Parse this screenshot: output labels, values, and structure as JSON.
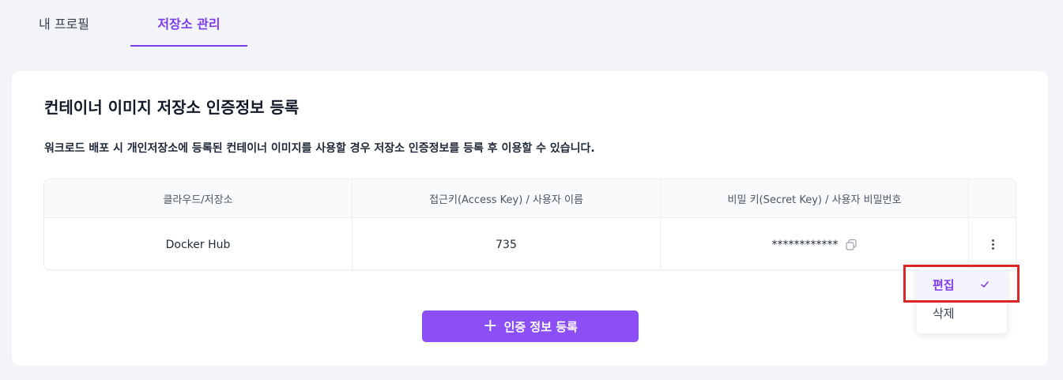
{
  "tabs": [
    {
      "label": "내 프로필",
      "active": false
    },
    {
      "label": "저장소 관리",
      "active": true
    }
  ],
  "card": {
    "title": "컨테이너 이미지 저장소 인증정보 등록",
    "description": "워크로드 배포 시 개인저장소에 등록된 컨테이너 이미지를 사용할 경우 저장소 인증정보를 등록 후 이용할 수 있습니다."
  },
  "table": {
    "columns": [
      "클라우드/저장소",
      "접근키(Access Key) / 사용자 이름",
      "비밀 키(Secret Key) / 사용자 비밀번호",
      ""
    ],
    "rows": [
      {
        "registry": "Docker Hub",
        "access_key": "735",
        "secret_key": "************"
      }
    ]
  },
  "add_button": {
    "label": "인증 정보 등록"
  },
  "menu": {
    "items": [
      {
        "label": "편집",
        "selected": true
      },
      {
        "label": "삭제",
        "selected": false
      }
    ]
  },
  "colors": {
    "accent": "#7c3aed",
    "button": "#8b4ff5",
    "highlight_box": "#dc2626"
  },
  "icons": {
    "copy": "copy-icon",
    "kebab": "more-vertical-icon",
    "plus": "plus-icon",
    "check": "check-icon"
  }
}
